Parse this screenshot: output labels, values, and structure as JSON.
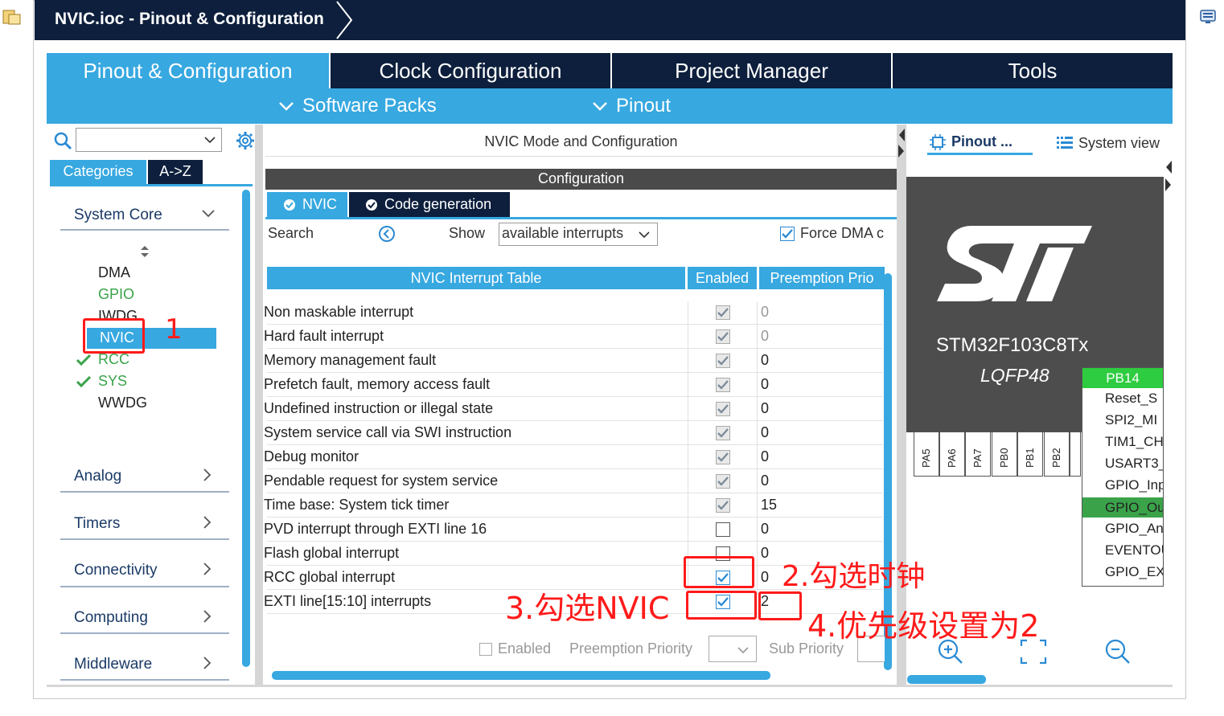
{
  "window": {
    "title": "NVIC.ioc - Pinout & Configuration"
  },
  "main_tabs": [
    {
      "label": "Pinout & Configuration"
    },
    {
      "label": "Clock Configuration"
    },
    {
      "label": "Project Manager"
    },
    {
      "label": "Tools"
    }
  ],
  "sub_tabs": [
    {
      "label": "Software Packs"
    },
    {
      "label": "Pinout"
    }
  ],
  "sidebar": {
    "search": {
      "value": ""
    },
    "tabs": [
      "Categories",
      "A->Z"
    ],
    "categories": [
      "System Core",
      "Analog",
      "Timers",
      "Connectivity",
      "Computing",
      "Middleware"
    ],
    "system_core_items": [
      {
        "label": "DMA",
        "checked": false,
        "color": "#222222"
      },
      {
        "label": "GPIO",
        "checked": false,
        "color": "#3aa34a"
      },
      {
        "label": "IWDG",
        "checked": false,
        "color": "#222222"
      },
      {
        "label": "NVIC",
        "checked": false,
        "selected": true
      },
      {
        "label": "RCC",
        "checked": true,
        "color": "#3aa34a"
      },
      {
        "label": "SYS",
        "checked": true,
        "color": "#3aa34a"
      },
      {
        "label": "WWDG",
        "checked": false,
        "color": "#222222"
      }
    ]
  },
  "config_panel": {
    "header": "NVIC Mode and Configuration",
    "section_title": "Configuration",
    "tabs": [
      "NVIC",
      "Code generation"
    ],
    "toolbar": {
      "search_label": "Search",
      "show_label": "Show",
      "show_value": "available interrupts",
      "force_dma_label": "Force DMA c",
      "force_dma_checked": true
    },
    "table": {
      "headers": [
        "NVIC Interrupt Table",
        "Enabled",
        "Preemption Prio"
      ],
      "rows": [
        {
          "name": "Non maskable interrupt",
          "enabled": true,
          "locked": true,
          "priority": "0"
        },
        {
          "name": "Hard fault interrupt",
          "enabled": true,
          "locked": true,
          "priority": "0"
        },
        {
          "name": "Memory management fault",
          "enabled": true,
          "locked": true,
          "priority": "0"
        },
        {
          "name": "Prefetch fault, memory access fault",
          "enabled": true,
          "locked": true,
          "priority": "0"
        },
        {
          "name": "Undefined instruction or illegal state",
          "enabled": true,
          "locked": true,
          "priority": "0"
        },
        {
          "name": "System service call via SWI instruction",
          "enabled": true,
          "locked": true,
          "priority": "0"
        },
        {
          "name": "Debug monitor",
          "enabled": true,
          "locked": true,
          "priority": "0"
        },
        {
          "name": "Pendable request for system service",
          "enabled": true,
          "locked": true,
          "priority": "0"
        },
        {
          "name": "Time base: System tick timer",
          "enabled": true,
          "locked": true,
          "priority": "15"
        },
        {
          "name": "PVD interrupt through EXTI line 16",
          "enabled": false,
          "locked": false,
          "priority": "0"
        },
        {
          "name": "Flash global interrupt",
          "enabled": false,
          "locked": false,
          "priority": "0"
        },
        {
          "name": "RCC global interrupt",
          "enabled": true,
          "locked": false,
          "priority": "0"
        },
        {
          "name": "EXTI line[15:10] interrupts",
          "enabled": true,
          "locked": false,
          "priority": "2"
        }
      ]
    },
    "footer": {
      "enabled_label": "Enabled",
      "preemption_label": "Preemption Priority",
      "sub_priority_label": "Sub Priority"
    }
  },
  "pinout_panel": {
    "tabs": [
      "Pinout ...",
      "System view"
    ],
    "chip_name": "STM32F103C8Tx",
    "package": "LQFP48",
    "pins": [
      "PA5",
      "PA6",
      "PA7",
      "PB0",
      "PB1",
      "PB2"
    ],
    "popup_title": "PB14",
    "popup_items": [
      "Reset_S",
      "SPI2_MI",
      "TIM1_CH",
      "USART3_",
      "GPIO_Inp",
      "GPIO_Ou",
      "GPIO_An",
      "EVENTOU",
      "GPIO_EX"
    ]
  },
  "annotations": {
    "step1": "1",
    "step2": "2.勾选时钟",
    "step3": "3.勾选NVIC",
    "step4": "4.优先级设置为2"
  },
  "colors": {
    "navy": "#0d1f3c",
    "accent_blue": "#37a8e0",
    "annotation_red": "#ff1a1a",
    "ok_green": "#3aa34a"
  }
}
